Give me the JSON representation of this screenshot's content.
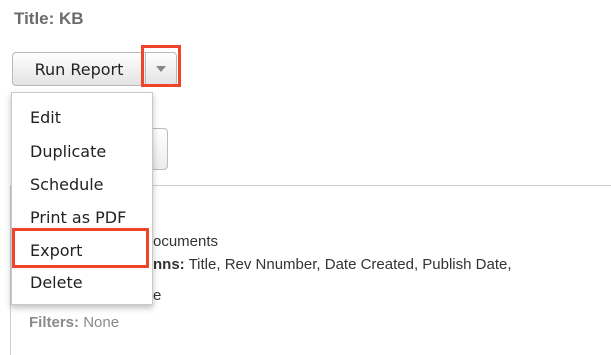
{
  "report": {
    "title": "Title: KB"
  },
  "actions": {
    "run_report_label": "Run Report"
  },
  "menu": {
    "items": [
      {
        "label": "Edit"
      },
      {
        "label": "Duplicate"
      },
      {
        "label": "Schedule"
      },
      {
        "label": "Print as PDF"
      },
      {
        "label": "Export"
      },
      {
        "label": "Delete"
      }
    ],
    "highlighted": "Export"
  },
  "details": {
    "module_value_partial": "ocuments",
    "columns_label_partial": "nns:",
    "columns_value": "Title, Rev Nnumber, Date Created, Publish Date,",
    "group_value_partial": "e",
    "filters_label": "Filters:",
    "filters_value": "None"
  },
  "colors": {
    "highlight": "#f0432c"
  },
  "icons": {
    "dropdown_caret": "chevron-down-icon"
  }
}
